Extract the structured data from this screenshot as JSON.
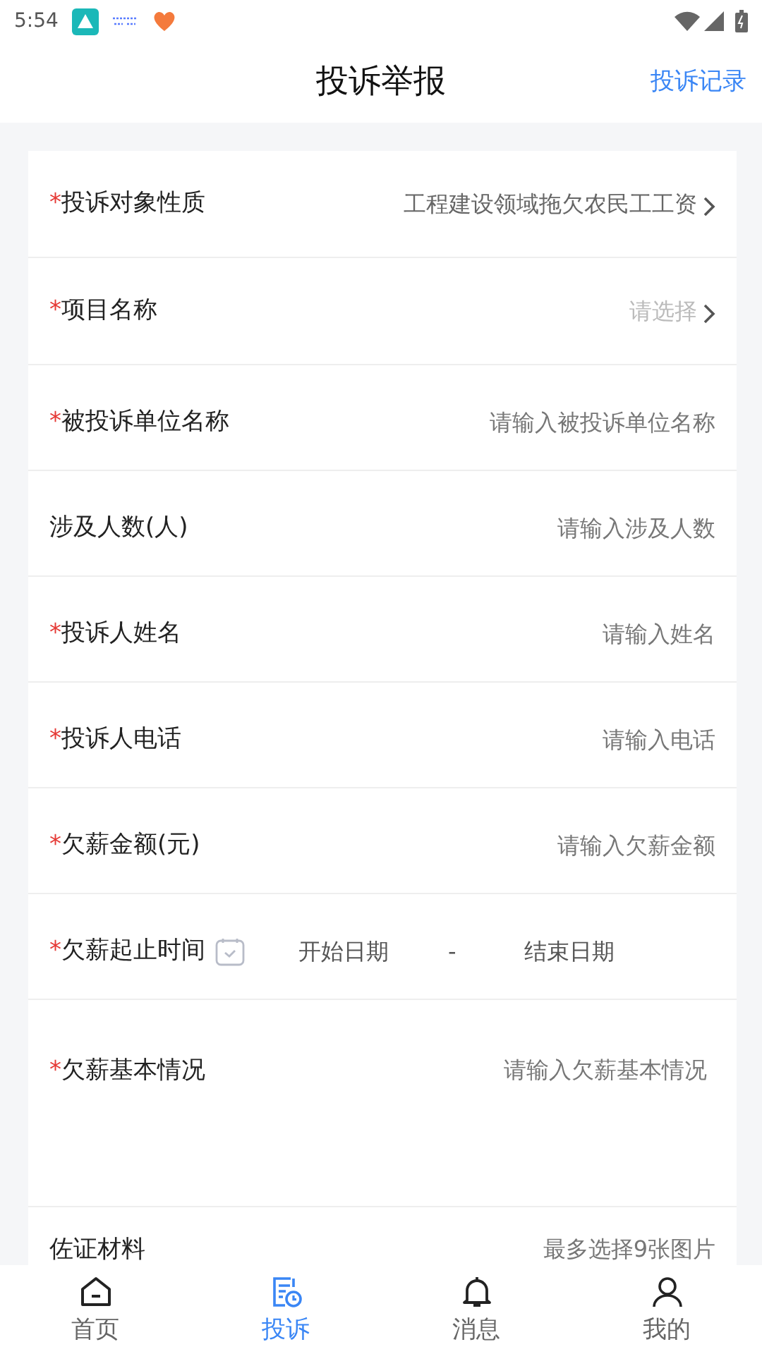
{
  "status_bar": {
    "time": "5:54"
  },
  "header": {
    "title": "投诉举报",
    "action": "投诉记录"
  },
  "form": {
    "rows": [
      {
        "kind": "select",
        "label": "投诉对象性质",
        "required_mark": "*",
        "value": "工程建设领域拖欠农民工工资",
        "filled": true
      },
      {
        "kind": "select",
        "label": "项目名称",
        "required_mark": "*",
        "value": "请选择",
        "filled": false
      },
      {
        "kind": "input",
        "label": "被投诉单位名称",
        "required_mark": "*",
        "placeholder": "请输入被投诉单位名称"
      },
      {
        "kind": "input",
        "label": "涉及人数(人)",
        "placeholder": "请输入涉及人数"
      },
      {
        "kind": "input",
        "label": "投诉人姓名",
        "required_mark": "*",
        "placeholder": "请输入姓名"
      },
      {
        "kind": "input",
        "label": "投诉人电话",
        "required_mark": "*",
        "placeholder": "请输入电话"
      },
      {
        "kind": "input",
        "label": "欠薪金额(元)",
        "required_mark": "*",
        "placeholder": "请输入欠薪金额"
      },
      {
        "kind": "daterange",
        "label": "欠薪起止时间",
        "required_mark": "*",
        "start": "开始日期",
        "separator": "-",
        "end": "结束日期"
      },
      {
        "kind": "textarea",
        "label": "欠薪基本情况",
        "required_mark": "*",
        "placeholder": "请输入欠薪基本情况"
      },
      {
        "kind": "upload",
        "label": "佐证材料",
        "hint": "最多选择9张图片"
      }
    ]
  },
  "tab_bar": [
    {
      "label": "首页",
      "selected": false,
      "kind": "home"
    },
    {
      "label": "投诉",
      "selected": true,
      "kind": "complaint"
    },
    {
      "label": "消息",
      "selected": false,
      "kind": "bell"
    },
    {
      "label": "我的",
      "selected": false,
      "kind": "user"
    }
  ]
}
